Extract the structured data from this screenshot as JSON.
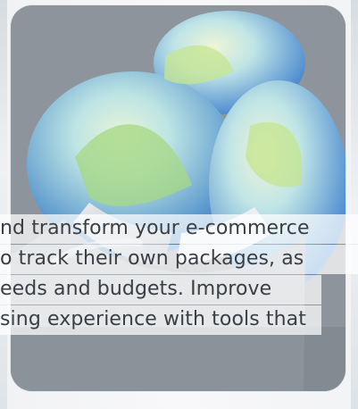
{
  "hero": {
    "lines": [
      "nd transform your e-commerce",
      "o track their own packages, as",
      "eeds and budgets. Improve",
      "sing experience with tools that"
    ]
  }
}
